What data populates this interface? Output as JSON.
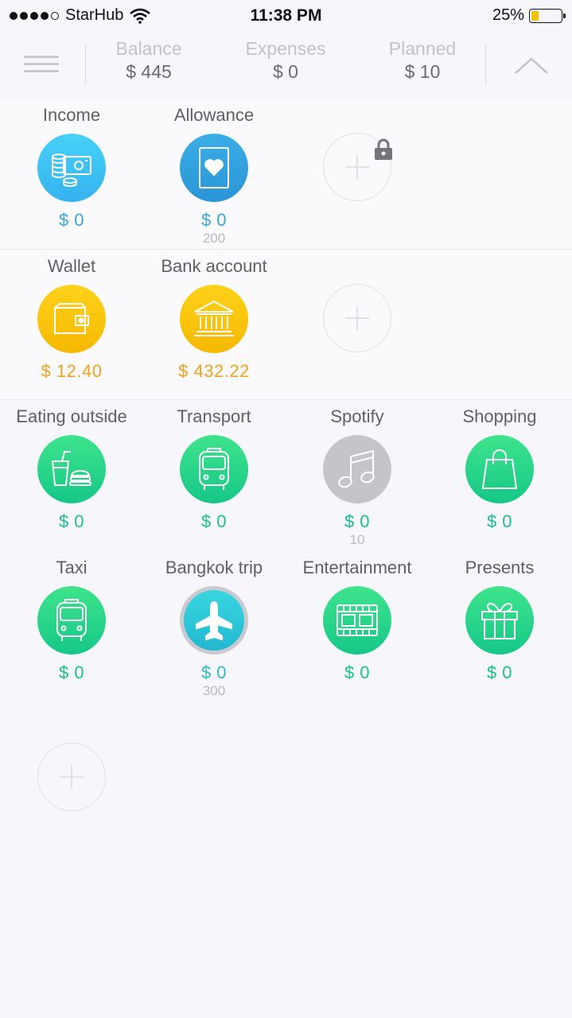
{
  "status": {
    "carrier": "StarHub",
    "time": "11:38 PM",
    "battery": "25%",
    "battery_level": 0.25
  },
  "header": {
    "balance": {
      "label": "Balance",
      "value": "$ 445"
    },
    "expenses": {
      "label": "Expenses",
      "value": "$ 0"
    },
    "planned": {
      "label": "Planned",
      "value": "$ 10"
    }
  },
  "income": [
    {
      "name": "Income",
      "amount": "$ 0",
      "icon": "coins-banknote-icon",
      "color": "#36b2ef"
    },
    {
      "name": "Allowance",
      "amount": "$ 0",
      "sub": "200",
      "icon": "card-heart-icon",
      "color": "#2b95d6"
    }
  ],
  "accounts": [
    {
      "name": "Wallet",
      "amount": "$ 12.40",
      "icon": "wallet-icon",
      "color": "#f6b800"
    },
    {
      "name": "Bank account",
      "amount": "$ 432.22",
      "icon": "bank-icon",
      "color": "#f6b800"
    }
  ],
  "expenses": [
    {
      "name": "Eating outside",
      "amount": "$ 0",
      "icon": "cup-burger-icon"
    },
    {
      "name": "Transport",
      "amount": "$ 0",
      "icon": "bus-icon"
    },
    {
      "name": "Spotify",
      "amount": "$ 0",
      "sub": "10",
      "icon": "music-note-icon"
    },
    {
      "name": "Shopping",
      "amount": "$ 0",
      "icon": "shopping-bag-icon"
    },
    {
      "name": "Taxi",
      "amount": "$ 0",
      "icon": "bus-icon"
    },
    {
      "name": "Bangkok trip",
      "amount": "$ 0",
      "sub": "300",
      "icon": "airplane-icon"
    },
    {
      "name": "Entertainment",
      "amount": "$ 0",
      "icon": "film-icon"
    },
    {
      "name": "Presents",
      "amount": "$ 0",
      "icon": "gift-icon"
    }
  ]
}
